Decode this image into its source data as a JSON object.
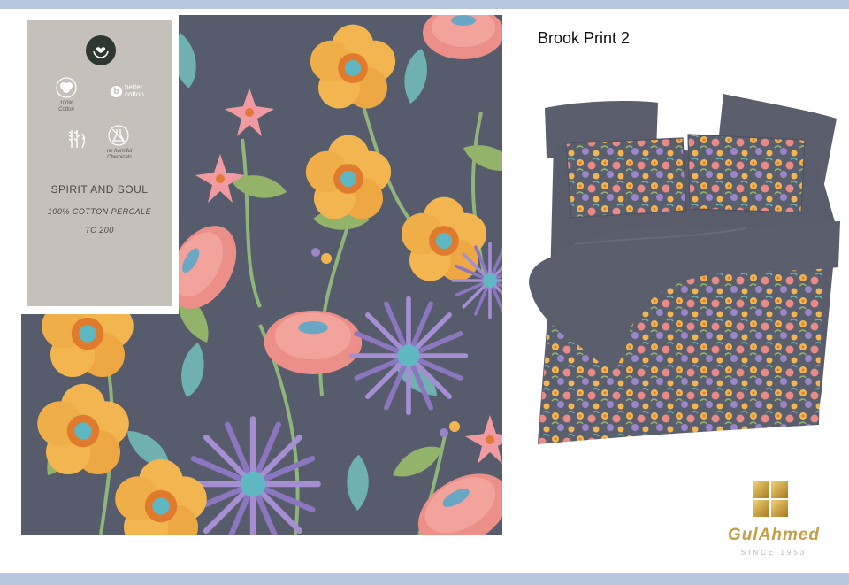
{
  "product_sheet": {
    "print_title": "Brook Print 2",
    "label_card": {
      "collection_name": "SPIRIT AND SOUL",
      "fabric": "100% COTTON PERCALE",
      "thread_count": "TC 200",
      "certifications": [
        {
          "icon": "cotton-boll-icon",
          "caption_line1": "100%",
          "caption_line2": "Cotton"
        },
        {
          "icon": "better-cotton-logo",
          "brand_text_line1": "better",
          "brand_text_line2": "cotton"
        },
        {
          "icon": "wheat-leaves-icon"
        },
        {
          "icon": "flask-crossed-icon",
          "caption_line1": "no harmful",
          "caption_line2": "Chemicals"
        }
      ],
      "badge_icon": "hands-heart-icon"
    },
    "brand": {
      "name": "GulAhmed",
      "since": "SINCE 1953",
      "mark_colors": [
        "#f1d27a",
        "#a8781c"
      ]
    }
  },
  "colors": {
    "band": "#b7c7dc",
    "fabric_ground": "#575c6d",
    "card_bg": "#c6c0bb",
    "sheet_gray": "#5b5f6d",
    "flower_yellow": "#f2b54f",
    "flower_pink": "#ea8a86",
    "flower_purple": "#9b86c9",
    "leaf_green": "#93b26a",
    "leaf_teal": "#6fb1b0",
    "brand_gold": "#c3a047"
  }
}
